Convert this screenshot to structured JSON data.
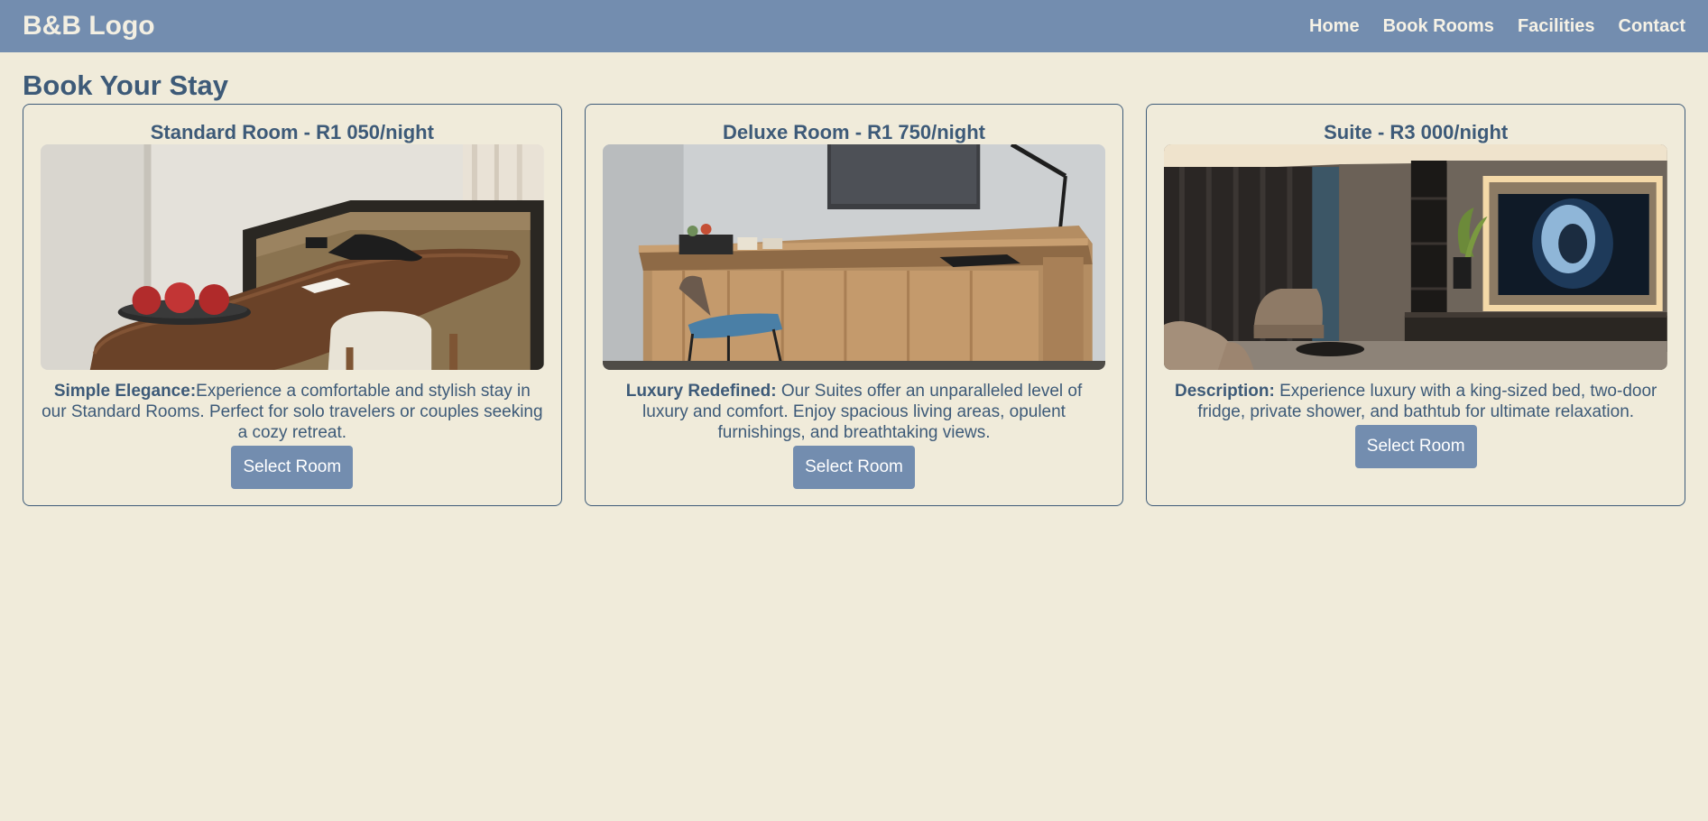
{
  "header": {
    "logo": "B&B Logo",
    "nav": [
      {
        "label": "Home"
      },
      {
        "label": "Book Rooms"
      },
      {
        "label": "Facilities"
      },
      {
        "label": "Contact"
      }
    ]
  },
  "page": {
    "title": "Book Your Stay"
  },
  "rooms": [
    {
      "title": "Standard Room - R1 050/night",
      "desc_label": "Simple Elegance:",
      "desc_text": "Experience a comfortable and stylish stay in our Standard Rooms. Perfect for solo travelers or couples seeking a cozy retreat.",
      "button": "Select Room",
      "image": "standard room desk with apples"
    },
    {
      "title": "Deluxe Room - R1 750/night",
      "desc_label": "Luxury Redefined:",
      "desc_text": " Our Suites offer an unparalleled level of luxury and comfort. Enjoy spacious living areas, opulent furnishings, and breathtaking views.",
      "button": "Select Room",
      "image": "deluxe room wooden desk with blue chair"
    },
    {
      "title": "Suite - R3 000/night",
      "desc_label": "Description:",
      "desc_text": " Experience luxury with a king-sized bed, two-door fridge, private shower, and bathtub for ultimate relaxation.",
      "button": "Select Room",
      "image": "suite living room with wall TV"
    }
  ],
  "colors": {
    "background": "#f0ebda",
    "accent": "#738daf",
    "text": "#3d5a78"
  }
}
